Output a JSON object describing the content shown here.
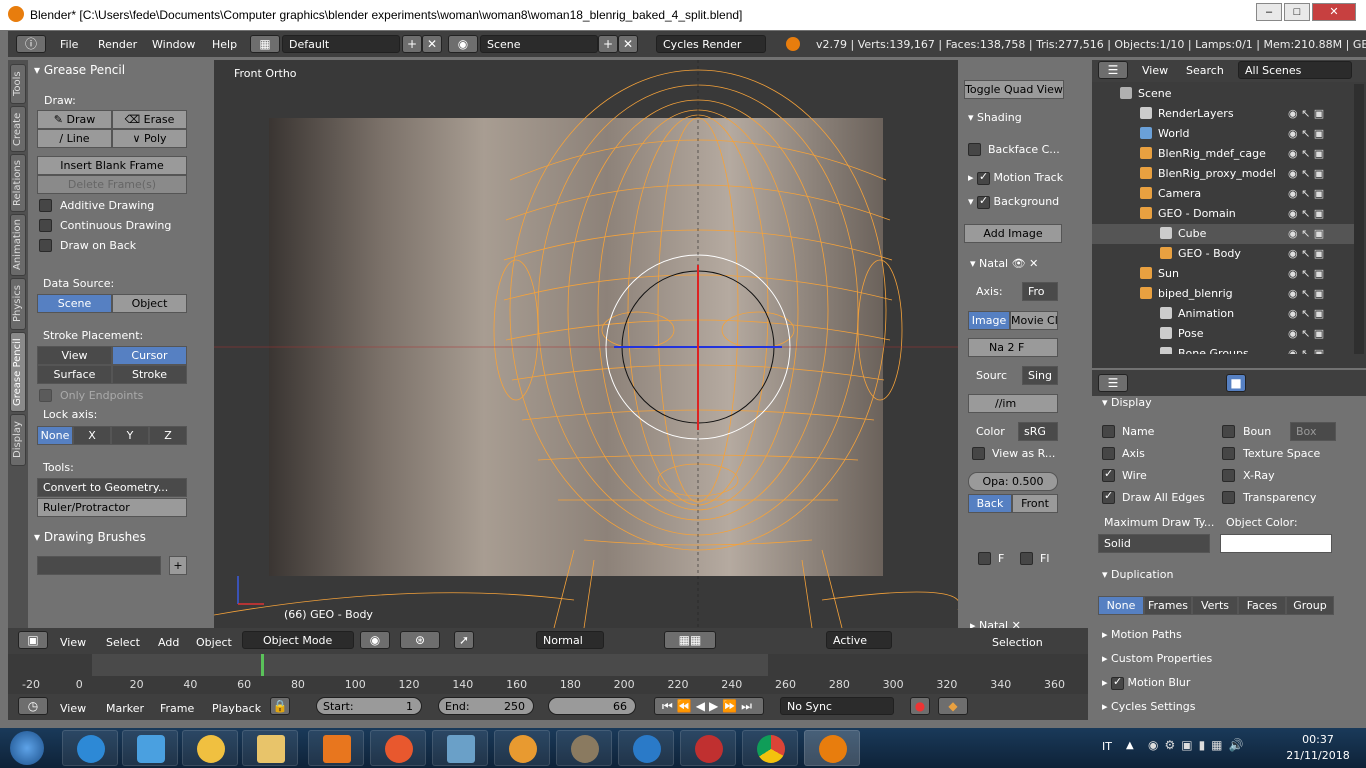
{
  "window": {
    "title": "Blender* [C:\\Users\\fede\\Documents\\Computer graphics\\blender experiments\\woman\\woman8\\woman18_blenrig_baked_4_split.blend]",
    "minimize": "–",
    "maximize": "□",
    "close": "✕"
  },
  "menu": {
    "file": "File",
    "render": "Render",
    "window": "Window",
    "help": "Help",
    "layout": "Default",
    "scene": "Scene",
    "engine": "Cycles Render",
    "stats": "v2.79 | Verts:139,167 | Faces:138,758 | Tris:277,516 | Objects:1/10 | Lamps:0/1 | Mem:210.88M | GEO - Body"
  },
  "tabs": [
    "Tools",
    "Create",
    "Relations",
    "Animation",
    "Physics",
    "Grease Pencil",
    "Display"
  ],
  "gp": {
    "panel": "Grease Pencil",
    "draw": "Draw:",
    "draw_btn": "Draw",
    "erase": "Erase",
    "line": "Line",
    "poly": "Poly",
    "insert": "Insert Blank Frame",
    "delete": "Delete Frame(s)",
    "additive": "Additive Drawing",
    "continuous": "Continuous Drawing",
    "drawback": "Draw on Back",
    "datasource": "Data Source:",
    "ds_scene": "Scene",
    "ds_object": "Object",
    "placement": "Stroke Placement:",
    "view": "View",
    "cursor": "Cursor",
    "surface": "Surface",
    "stroke": "Stroke",
    "endpoints": "Only Endpoints",
    "lock": "Lock axis:",
    "none": "None",
    "x": "X",
    "y": "Y",
    "z": "Z",
    "tools": "Tools:",
    "convert": "Convert to Geometry...",
    "ruler": "Ruler/Protractor",
    "brushes": "Drawing Brushes"
  },
  "viewport": {
    "label": "Front Ortho",
    "object_label": "(66) GEO - Body"
  },
  "npanel": {
    "toggle": "Toggle Quad View",
    "shading": "Shading",
    "backface": "Backface C...",
    "motion": "Motion Track",
    "background": "Background",
    "add_image": "Add Image",
    "natal": "Natal",
    "axis_lbl": "Axis:",
    "axis_val": "Fro",
    "image": "Image",
    "movie": "Movie Cl",
    "img_name": "Na",
    "img_num": "2",
    "img_f": "F",
    "source_lbl": "Sourc",
    "source_val": "Sing",
    "path": "//im",
    "color_lbl": "Color",
    "color_val": "sRG",
    "viewas": "View as R...",
    "opacity": "Opa: 0.500",
    "back": "Back",
    "front": "Front",
    "f1": "F",
    "f2": "Fl",
    "natal2": "Natal"
  },
  "outliner": {
    "view": "View",
    "search": "Search",
    "scenes": "All Scenes",
    "items": [
      {
        "label": "Scene",
        "indent": 0,
        "color": "#b0b0b0"
      },
      {
        "label": "RenderLayers",
        "indent": 1,
        "color": "#cccccc"
      },
      {
        "label": "World",
        "indent": 1,
        "color": "#6aa0d8"
      },
      {
        "label": "BlenRig_mdef_cage",
        "indent": 1,
        "color": "#e8a040"
      },
      {
        "label": "BlenRig_proxy_model",
        "indent": 1,
        "color": "#e8a040"
      },
      {
        "label": "Camera",
        "indent": 1,
        "color": "#e8a040"
      },
      {
        "label": "GEO - Domain",
        "indent": 1,
        "color": "#e8a040"
      },
      {
        "label": "Cube",
        "indent": 2,
        "color": "#cccccc"
      },
      {
        "label": "GEO - Body",
        "indent": 2,
        "color": "#e8a040"
      },
      {
        "label": "Sun",
        "indent": 1,
        "color": "#e8a040"
      },
      {
        "label": "biped_blenrig",
        "indent": 1,
        "color": "#e8a040"
      },
      {
        "label": "Animation",
        "indent": 2,
        "color": "#cccccc"
      },
      {
        "label": "Pose",
        "indent": 2,
        "color": "#cccccc"
      },
      {
        "label": "Bone Groups",
        "indent": 2,
        "color": "#cccccc"
      }
    ]
  },
  "props": {
    "display": "Display",
    "name": "Name",
    "bounds": "Boun",
    "bounds_val": "Box",
    "axis": "Axis",
    "texture": "Texture Space",
    "wire": "Wire",
    "xray": "X-Ray",
    "alledges": "Draw All Edges",
    "transparency": "Transparency",
    "maxdraw": "Maximum Draw Ty...",
    "objcolor": "Object Color:",
    "solid": "Solid",
    "duplication": "Duplication",
    "dup": [
      "None",
      "Frames",
      "Verts",
      "Faces",
      "Group"
    ],
    "motionpaths": "Motion Paths",
    "custom": "Custom Properties",
    "motionblur": "Motion Blur",
    "cycles": "Cycles Settings"
  },
  "vheader": {
    "view": "View",
    "select": "Select",
    "add": "Add",
    "object": "Object",
    "mode": "Object Mode",
    "orient": "Normal",
    "pivot": "Active",
    "selection": "Selection"
  },
  "timeline": {
    "ticks": [
      "-20",
      "0",
      "20",
      "40",
      "60",
      "80",
      "100",
      "120",
      "140",
      "160",
      "180",
      "200",
      "220",
      "240",
      "260",
      "280",
      "300",
      "320",
      "340",
      "360"
    ],
    "current_frame": 66
  },
  "theader": {
    "view": "View",
    "marker": "Marker",
    "frame": "Frame",
    "playback": "Playback",
    "start": "Start:",
    "start_val": "1",
    "end": "End:",
    "end_val": "250",
    "frame_val": "66",
    "sync": "No Sync"
  },
  "taskbar": {
    "lang": "IT",
    "time": "00:37",
    "date": "21/11/2018"
  }
}
